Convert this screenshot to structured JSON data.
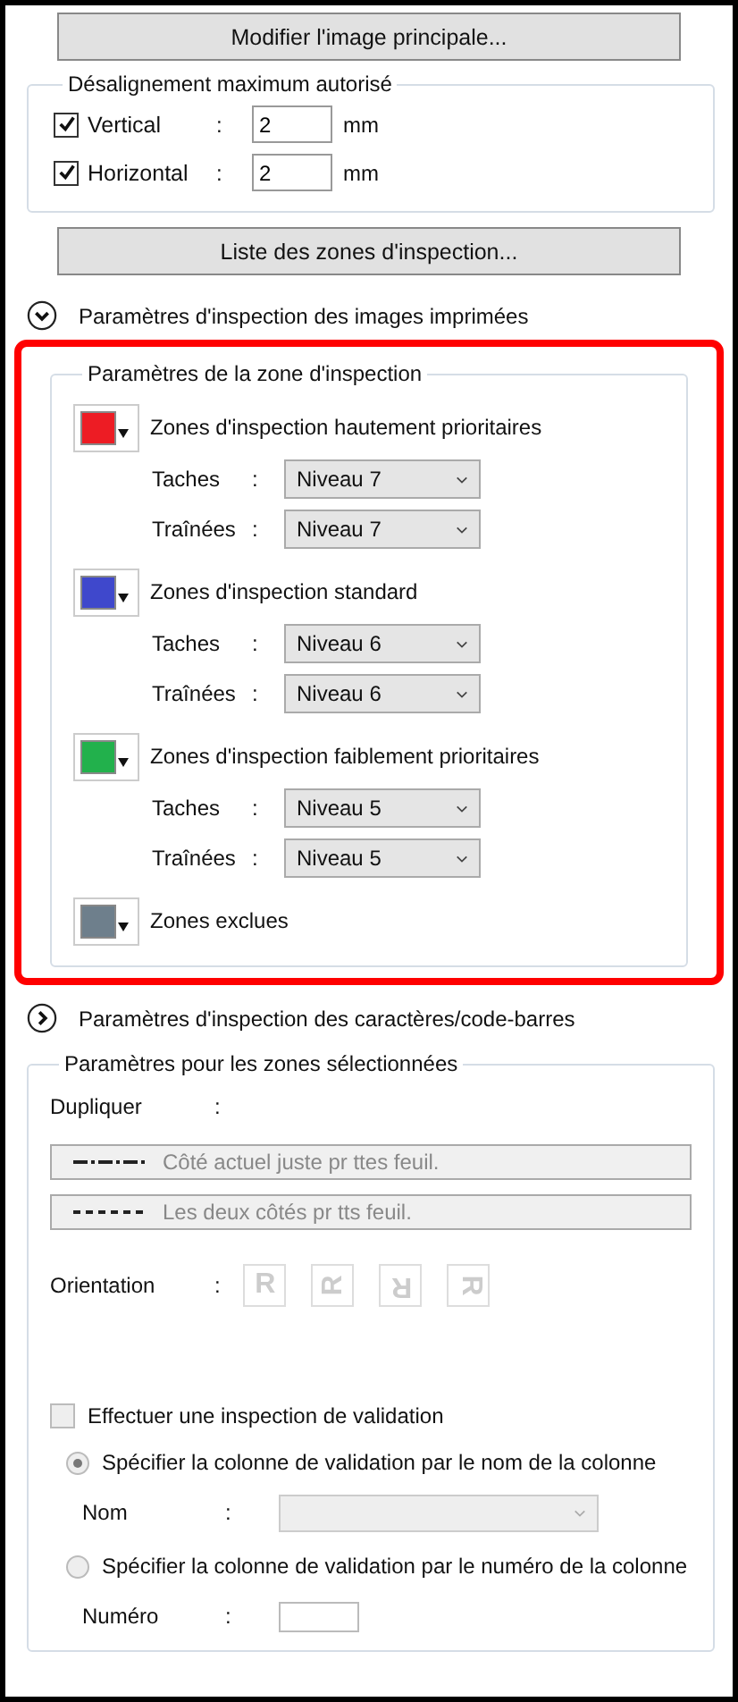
{
  "main_image_button": "Modifier l'image principale...",
  "misalignment": {
    "legend": "Désalignement maximum autorisé",
    "rows": [
      {
        "label": "Vertical",
        "checked": true,
        "colon": ":",
        "value": "2",
        "unit": "mm"
      },
      {
        "label": "Horizontal",
        "checked": true,
        "colon": ":",
        "value": "2",
        "unit": "mm"
      }
    ]
  },
  "zone_list_button": "Liste des zones d'inspection...",
  "print_section": {
    "label": "Paramètres d'inspection des images imprimées",
    "expanded": true
  },
  "zone_settings": {
    "highlighted": true,
    "legend": "Paramètres de la zone d'inspection",
    "zones": [
      {
        "label": "Zones d'inspection hautement prioritaires",
        "color": "#ed1c24",
        "settings": [
          {
            "label": "Taches",
            "colon": ":",
            "value": "Niveau 7"
          },
          {
            "label": "Traînées",
            "colon": ":",
            "value": "Niveau 7"
          }
        ]
      },
      {
        "label": "Zones d'inspection standard",
        "color": "#3f48cc",
        "settings": [
          {
            "label": "Taches",
            "colon": ":",
            "value": "Niveau 6"
          },
          {
            "label": "Traînées",
            "colon": ":",
            "value": "Niveau 6"
          }
        ]
      },
      {
        "label": "Zones d'inspection faiblement prioritaires",
        "color": "#22b14c",
        "settings": [
          {
            "label": "Taches",
            "colon": ":",
            "value": "Niveau 5"
          },
          {
            "label": "Traînées",
            "colon": ":",
            "value": "Niveau 5"
          }
        ]
      },
      {
        "label": "Zones exclues",
        "color": "#6e7f8c"
      }
    ]
  },
  "barcode_section": {
    "label": "Paramètres d'inspection des caractères/code-barres",
    "expanded": false
  },
  "selected_zones": {
    "legend": "Paramètres pour les zones sélectionnées",
    "duplicate": {
      "label": "Dupliquer",
      "colon": ":",
      "options": [
        {
          "kind": "dash-dot",
          "label": "Côté actuel juste pr ttes feuil.",
          "disabled": true
        },
        {
          "kind": "dashed",
          "label": "Les deux côtés pr tts feuil.",
          "disabled": true
        }
      ]
    },
    "orientation": {
      "label": "Orientation",
      "colon": ":",
      "disabled": true,
      "glyphs": [
        {
          "text": "R",
          "kind": "rotate-0"
        },
        {
          "text": "R",
          "kind": "rotate-90"
        },
        {
          "text": "R",
          "kind": "rotate-180"
        },
        {
          "text": "R",
          "kind": "rotate-270"
        }
      ]
    },
    "validation": {
      "label": "Effectuer une inspection de validation",
      "checked": false,
      "disabled": true
    },
    "methods": [
      {
        "label": "Spécifier la colonne de validation par le nom de la colonne",
        "selected": true,
        "field": {
          "kind": "dropdown",
          "label": "Nom",
          "colon": ":"
        }
      },
      {
        "label": "Spécifier la colonne de validation par le numéro de la colonne",
        "selected": false,
        "field": {
          "kind": "text",
          "label": "Numéro",
          "colon": ":"
        }
      }
    ]
  }
}
